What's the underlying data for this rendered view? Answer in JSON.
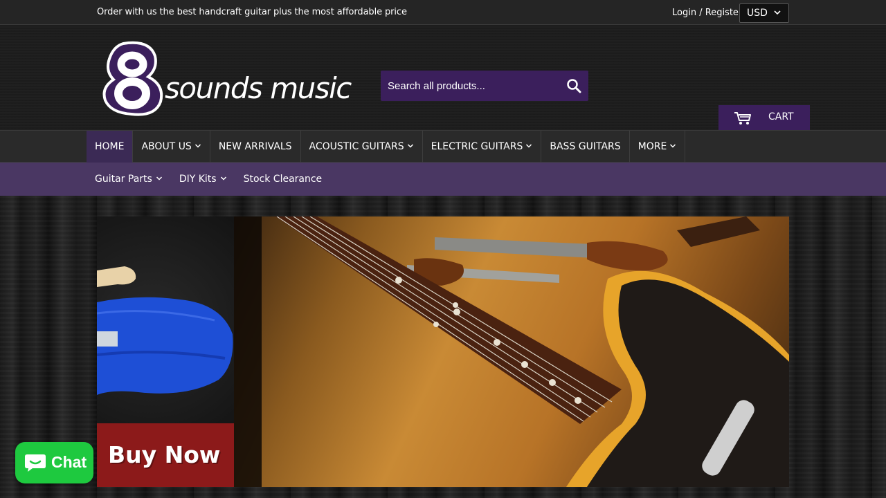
{
  "topbar": {
    "announcement": "Order with us the best handcraft guitar plus the most affordable price",
    "login": "Login",
    "separator": "/",
    "register": "Register",
    "currency": "USD"
  },
  "header": {
    "logo_numeral": "8",
    "logo_text": "sounds music",
    "search_placeholder": "Search all products...",
    "cart_label": "CART"
  },
  "main_nav": [
    {
      "label": "HOME",
      "active": true,
      "dropdown": false
    },
    {
      "label": "ABOUT US",
      "active": false,
      "dropdown": true
    },
    {
      "label": "NEW ARRIVALS",
      "active": false,
      "dropdown": false
    },
    {
      "label": "ACOUSTIC GUITARS",
      "active": false,
      "dropdown": true
    },
    {
      "label": "ELECTRIC GUITARS",
      "active": false,
      "dropdown": true
    },
    {
      "label": "BASS GUITARS",
      "active": false,
      "dropdown": false
    },
    {
      "label": "MORE",
      "active": false,
      "dropdown": true
    }
  ],
  "sub_nav": [
    {
      "label": "Guitar Parts",
      "dropdown": true
    },
    {
      "label": "DIY Kits",
      "dropdown": true
    },
    {
      "label": "Stock Clearance",
      "dropdown": false
    }
  ],
  "banner": {
    "cta": "Buy Now"
  },
  "chat": {
    "label": "Chat"
  },
  "colors": {
    "brand_purple": "#3b1f5c",
    "subnav_purple": "#4a3763",
    "chat_green": "#1ec93f",
    "cta_red": "#8c1a1a"
  },
  "icons": [
    "search-icon",
    "cart-icon",
    "chevron-down-icon",
    "chat-bubble-icon"
  ]
}
